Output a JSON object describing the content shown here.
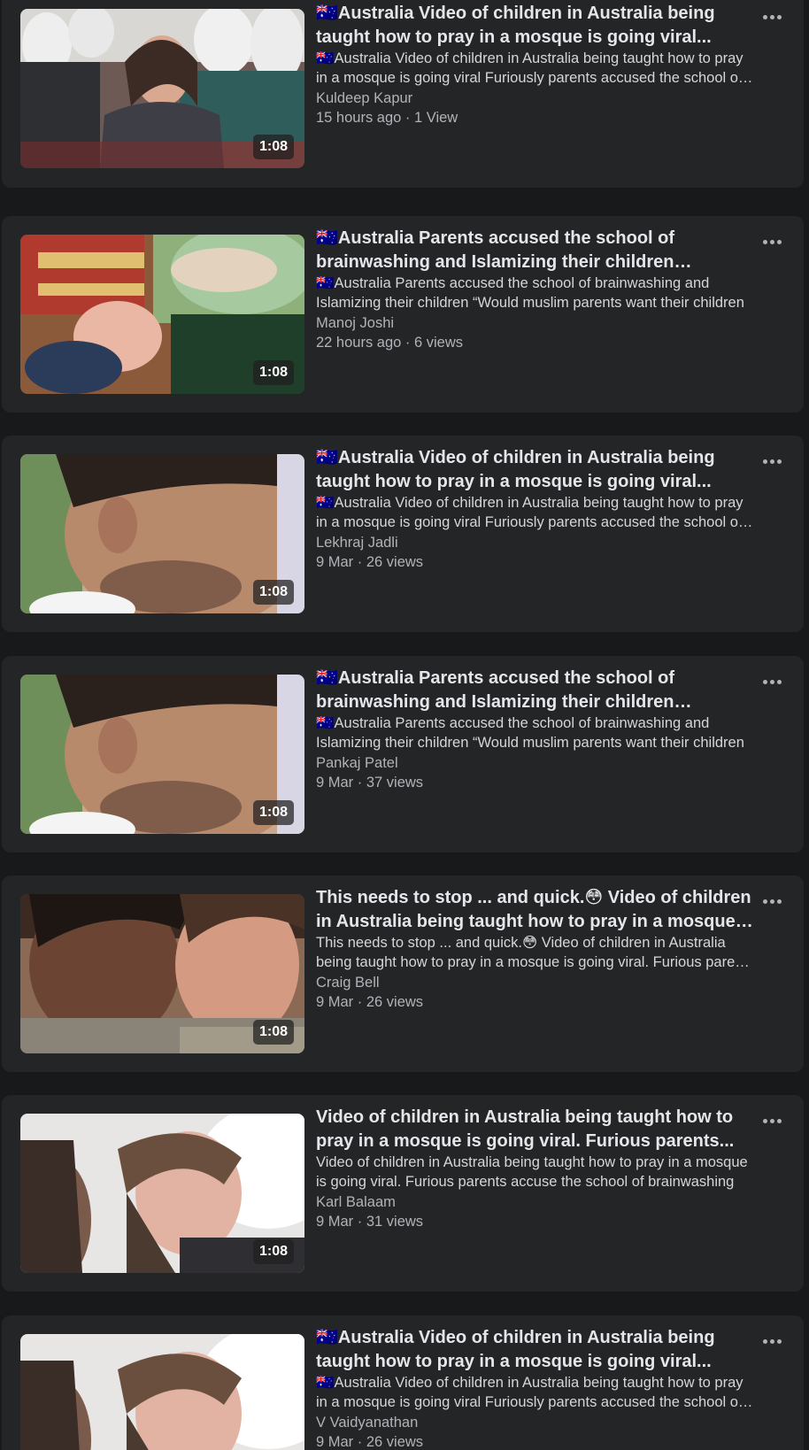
{
  "duration_label": "1:08",
  "more_icon": "more-horizontal-icon",
  "videos": [
    {
      "title": "🇦🇺Australia Video of children in Australia being taught how to pray in a mosque is going viral...",
      "description": "🇦🇺Australia Video of children in Australia being taught how to pray in a mosque is going viral Furiously parents accused the school of brainwashing",
      "author": "Kuldeep Kapur",
      "meta": "15 hours ago · 1 View"
    },
    {
      "title": "🇦🇺Australia Parents accused the school of brainwashing and Islamizing their children “Would...",
      "description": "🇦🇺Australia Parents accused the school of brainwashing and Islamizing their children “Would muslim parents want their children",
      "author": "Manoj Joshi",
      "meta": "22 hours ago · 6 views"
    },
    {
      "title": "🇦🇺Australia Video of children in Australia being taught how to pray in a mosque is going viral...",
      "description": "🇦🇺Australia Video of children in Australia being taught how to pray in a mosque is going viral Furiously parents accused the school of brainwashing",
      "author": "Lekhraj Jadli",
      "meta": "9 Mar · 26 views"
    },
    {
      "title": "🇦🇺Australia Parents accused the school of brainwashing and Islamizing their children “Would...",
      "description": "🇦🇺Australia Parents accused the school of brainwashing and Islamizing their children “Would muslim parents want their children",
      "author": "Pankaj Patel",
      "meta": "9 Mar · 37 views"
    },
    {
      "title": "This needs to stop ... and quick.😳 Video of children in Australia being taught how to pray in a mosque i...",
      "description": "This needs to stop ... and quick.😳 Video of children in Australia being taught how to pray in a mosque is going viral. Furious parents accuse",
      "author": "Craig Bell",
      "meta": "9 Mar · 26 views"
    },
    {
      "title": "Video of children in Australia being taught how to pray in a mosque is going viral. Furious parents...",
      "description": "Video of children in Australia being taught how to pray in a mosque is going viral. Furious parents accuse the school of brainwashing",
      "author": "Karl Balaam",
      "meta": "9 Mar · 31 views"
    },
    {
      "title": "🇦🇺Australia Video of children in Australia being taught how to pray in a mosque is going viral...",
      "description": "🇦🇺Australia Video of children in Australia being taught how to pray in a mosque is going viral Furiously parents accused the school of brainwashing",
      "author": "V Vaidyanathan",
      "meta": "9 Mar · 26 views"
    }
  ]
}
